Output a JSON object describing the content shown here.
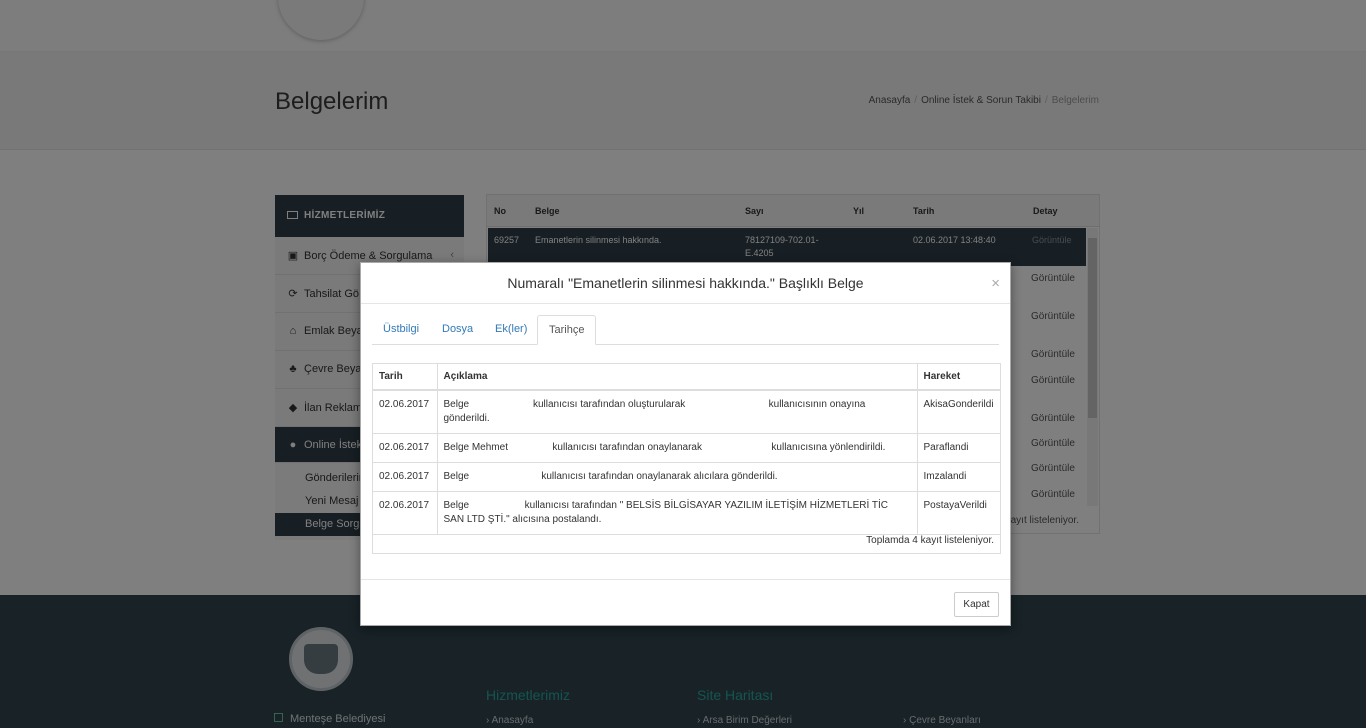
{
  "page": {
    "title": "Belgelerim",
    "breadcrumb": [
      "Anasayfa",
      "Online İstek & Sorun Takibi",
      "Belgelerim"
    ]
  },
  "sidebar": {
    "header": "HİZMETLERİMİZ",
    "items": [
      {
        "label": "Borç Ödeme & Sorgulama",
        "icon": "money-icon"
      },
      {
        "label": "Tahsilat Gö",
        "icon": "refresh-icon"
      },
      {
        "label": "Emlak Beya",
        "icon": "home-icon"
      },
      {
        "label": "Çevre Beyan",
        "icon": "tree-icon"
      },
      {
        "label": "İlan Reklam",
        "icon": "tag-icon"
      },
      {
        "label": "Online İstek",
        "icon": "microphone-icon"
      }
    ],
    "subitems": [
      "Gönderilerim",
      "Yeni Mesaj",
      "Belge Sorgu"
    ]
  },
  "bg_table": {
    "headers": [
      "No",
      "Belge",
      "Sayı",
      "Yıl",
      "Tarih",
      "Detay"
    ],
    "first_row": {
      "no": "69257",
      "belge": "Emanetlerin silinmesi hakkında.",
      "sayi": "78127109-702.01-",
      "sayi2": "E.4205",
      "tarih": "02.06.2017 13:48:40",
      "detay": "Görüntüle"
    },
    "links": [
      "Görüntüle",
      "Görüntüle",
      "Görüntüle",
      "Görüntüle",
      "Görüntüle",
      "Görüntüle",
      "Görüntüle",
      "Görüntüle"
    ],
    "footer": "kayıt listeleniyor."
  },
  "modal": {
    "title": "Numaralı \"Emanetlerin silinmesi hakkında.\" Başlıklı Belge",
    "close": "×",
    "tabs": [
      "Üstbilgi",
      "Dosya",
      "Ek(ler)",
      "Tarihçe"
    ],
    "active_tab": "Tarihçe",
    "history": {
      "headers": [
        "Tarih",
        "Açıklama",
        "Hareket"
      ],
      "rows": [
        {
          "tarih": "02.06.2017",
          "aciklama": "Belge                       kullanıcısı tarafından oluşturularak                              kullanıcısının onayına gönderildi.",
          "hareket": "AkisaGonderildi"
        },
        {
          "tarih": "02.06.2017",
          "aciklama": "Belge Mehmet                kullanıcısı tarafından onaylanarak                         kullanıcısına yönlendirildi.",
          "hareket": "Paraflandi"
        },
        {
          "tarih": "02.06.2017",
          "aciklama": "Belge                          kullanıcısı tarafından onaylanarak alıcılara gönderildi.",
          "hareket": "Imzalandi"
        },
        {
          "tarih": "02.06.2017",
          "aciklama": "Belge                    kullanıcısı tarafından \" BELSİS BİLGİSAYAR YAZILIM İLETİŞİM HİZMETLERİ TİC SAN LTD ŞTİ.\" alıcısına postalandı.",
          "hareket": "PostayaVerildi"
        }
      ],
      "total": "Toplamda 4 kayıt listeleniyor."
    },
    "close_button": "Kapat"
  },
  "footer": {
    "brand": "Menteşe Belediyesi",
    "col1_title": "Hizmetlerimiz",
    "col1_link": "Anasayfa",
    "col2_title": "Site Haritası",
    "col2_link": "Arsa Birim Değerleri",
    "col3_link": "Çevre Beyanları"
  },
  "colors": {
    "dark": "#2e3e48",
    "link": "#337ab7",
    "footer": "#31454f",
    "accent": "#2aa9a0"
  }
}
